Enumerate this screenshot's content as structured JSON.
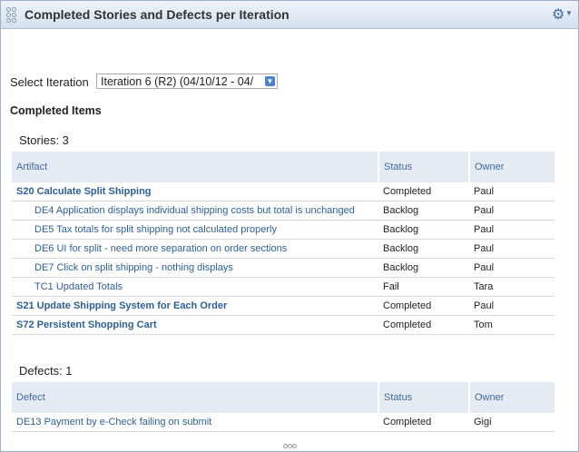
{
  "header": {
    "title": "Completed Stories and Defects per Iteration"
  },
  "iteration": {
    "label": "Select Iteration",
    "selected": "Iteration 6 (R2) (04/10/12 - 04/"
  },
  "completed_items_heading": "Completed Items",
  "stories": {
    "count_label": "Stories: 3",
    "columns": [
      "Artifact",
      "Status",
      "Owner"
    ],
    "rows": [
      {
        "artifact": "S20 Calculate Split Shipping",
        "status": "Completed",
        "owner": "Paul"
      },
      {
        "artifact": "DE4 Application displays individual shipping costs but total is unchanged",
        "status": "Backlog",
        "owner": "Paul"
      },
      {
        "artifact": "DE5 Tax totals for split shipping not calculated properly",
        "status": "Backlog",
        "owner": "Paul"
      },
      {
        "artifact": "DE6 UI for split - need more separation on order sections",
        "status": "Backlog",
        "owner": "Paul"
      },
      {
        "artifact": "DE7 Click on split shipping - nothing displays",
        "status": "Backlog",
        "owner": "Paul"
      },
      {
        "artifact": "TC1 Updated Totals",
        "status": "Fail",
        "owner": "Tara"
      },
      {
        "artifact": "S21 Update Shipping System for Each Order",
        "status": "Completed",
        "owner": "Paul"
      },
      {
        "artifact": "S72 Persistent Shopping Cart",
        "status": "Completed",
        "owner": "Tom"
      }
    ]
  },
  "defects": {
    "count_label": "Defects: 1",
    "columns": [
      "Defect",
      "Status",
      "Owner"
    ],
    "rows": [
      {
        "artifact": "DE13 Payment by e-Check failing on submit",
        "status": "Completed",
        "owner": "Gigi"
      }
    ]
  },
  "icons": {
    "gear": "gear-icon",
    "grip": "drag-grip-icon",
    "dropdown": "dropdown-arrow-icon",
    "resize": "resize-handle-icon"
  }
}
